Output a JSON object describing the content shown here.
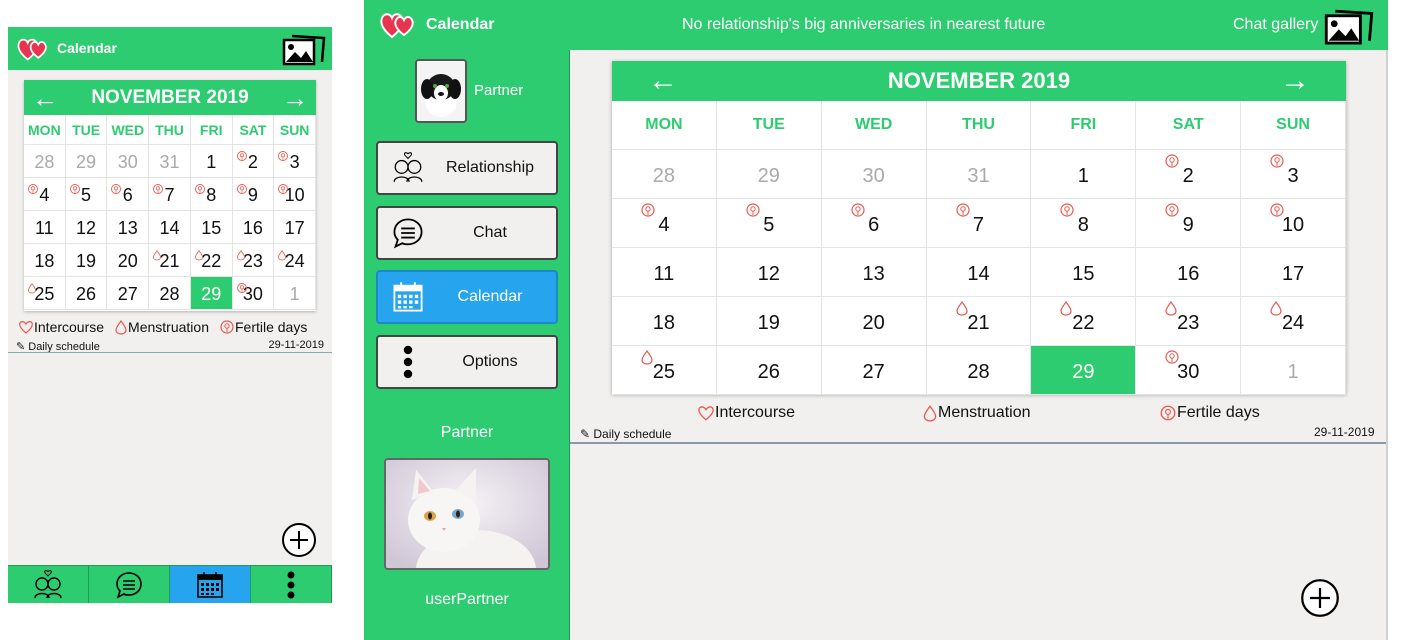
{
  "app": {
    "title": "Calendar",
    "notice": "No relationship's big anniversaries in nearest future",
    "gallery_label": "Chat gallery"
  },
  "sidebar": {
    "partner_name": "Partner",
    "items": [
      {
        "label": "Relationship",
        "icon": "couple-icon"
      },
      {
        "label": "Chat",
        "icon": "chat-bubble-icon"
      },
      {
        "label": "Calendar",
        "icon": "calendar-icon"
      },
      {
        "label": "Options",
        "icon": "more-vertical-icon"
      }
    ],
    "partner_label": "Partner",
    "user_label": "userPartner"
  },
  "calendar": {
    "month": "NOVEMBER 2019",
    "weekdays": [
      "MON",
      "TUE",
      "WED",
      "THU",
      "FRI",
      "SAT",
      "SUN"
    ],
    "days": [
      {
        "d": "28",
        "dim": true,
        "mark": ""
      },
      {
        "d": "29",
        "dim": true,
        "mark": ""
      },
      {
        "d": "30",
        "dim": true,
        "mark": ""
      },
      {
        "d": "31",
        "dim": true,
        "mark": ""
      },
      {
        "d": "1",
        "dim": false,
        "mark": ""
      },
      {
        "d": "2",
        "dim": false,
        "mark": "fertile"
      },
      {
        "d": "3",
        "dim": false,
        "mark": "fertile"
      },
      {
        "d": "4",
        "dim": false,
        "mark": "fertile"
      },
      {
        "d": "5",
        "dim": false,
        "mark": "fertile"
      },
      {
        "d": "6",
        "dim": false,
        "mark": "fertile"
      },
      {
        "d": "7",
        "dim": false,
        "mark": "fertile"
      },
      {
        "d": "8",
        "dim": false,
        "mark": "fertile"
      },
      {
        "d": "9",
        "dim": false,
        "mark": "fertile"
      },
      {
        "d": "10",
        "dim": false,
        "mark": "fertile"
      },
      {
        "d": "11",
        "dim": false,
        "mark": ""
      },
      {
        "d": "12",
        "dim": false,
        "mark": ""
      },
      {
        "d": "13",
        "dim": false,
        "mark": ""
      },
      {
        "d": "14",
        "dim": false,
        "mark": ""
      },
      {
        "d": "15",
        "dim": false,
        "mark": ""
      },
      {
        "d": "16",
        "dim": false,
        "mark": ""
      },
      {
        "d": "17",
        "dim": false,
        "mark": ""
      },
      {
        "d": "18",
        "dim": false,
        "mark": ""
      },
      {
        "d": "19",
        "dim": false,
        "mark": ""
      },
      {
        "d": "20",
        "dim": false,
        "mark": ""
      },
      {
        "d": "21",
        "dim": false,
        "mark": "menstruation"
      },
      {
        "d": "22",
        "dim": false,
        "mark": "menstruation"
      },
      {
        "d": "23",
        "dim": false,
        "mark": "menstruation"
      },
      {
        "d": "24",
        "dim": false,
        "mark": "menstruation"
      },
      {
        "d": "25",
        "dim": false,
        "mark": "menstruation"
      },
      {
        "d": "26",
        "dim": false,
        "mark": ""
      },
      {
        "d": "27",
        "dim": false,
        "mark": ""
      },
      {
        "d": "28",
        "dim": false,
        "mark": ""
      },
      {
        "d": "29",
        "dim": false,
        "mark": "",
        "today": true
      },
      {
        "d": "30",
        "dim": false,
        "mark": "fertile"
      },
      {
        "d": "1",
        "dim": true,
        "mark": ""
      }
    ]
  },
  "legend": {
    "intercourse": "Intercourse",
    "menstruation": "Menstruation",
    "fertile": "Fertile days"
  },
  "schedule": {
    "label": "Daily schedule",
    "date": "29-11-2019"
  },
  "colors": {
    "primary": "#2ecc71",
    "active_tab": "#27a4ee",
    "marker": "#e85a4f"
  }
}
